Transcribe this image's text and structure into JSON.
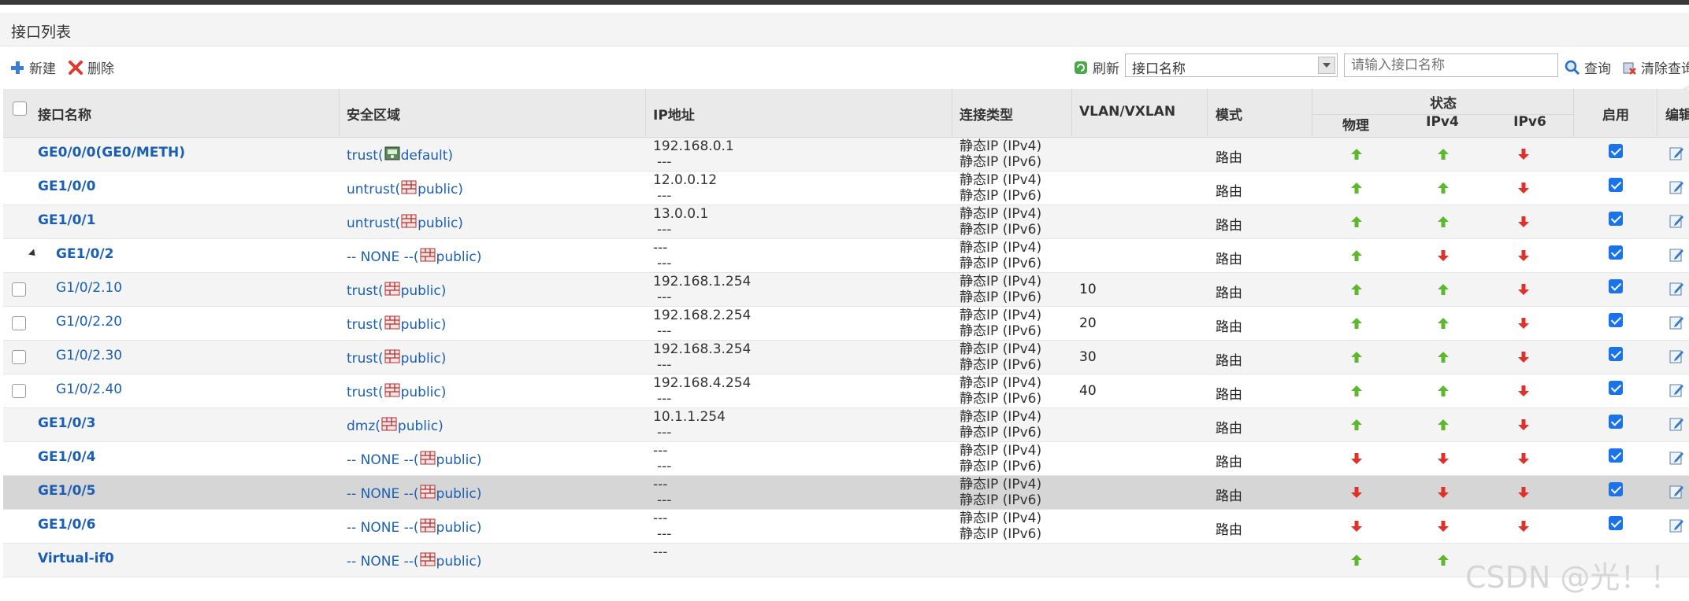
{
  "panel": {
    "title": "接口列表"
  },
  "toolbar": {
    "new_label": "新建",
    "delete_label": "删除",
    "refresh_label": "刷新",
    "filter_field": "接口名称",
    "search_placeholder": "请输入接口名称",
    "query_label": "查询",
    "clear_label": "清除查询"
  },
  "table": {
    "headers": {
      "name": "接口名称",
      "zone": "安全区域",
      "ip": "IP地址",
      "conn": "连接类型",
      "vlan": "VLAN/VXLAN",
      "mode": "模式",
      "status": "状态",
      "physical": "物理",
      "ipv4": "IPv4",
      "ipv6": "IPv6",
      "enable": "启用",
      "edit": "编辑"
    },
    "rows": [
      {
        "name": "GE0/0/0(GE0/METH)",
        "zone_prefix": "trust(",
        "zone_icon": "default-zone-icon",
        "zone_suffix": "default)",
        "ip1": "192.168.0.1",
        "ip2": "---",
        "conn1": "静态IP (IPv4)",
        "conn2": "静态IP (IPv6)",
        "vlan": "",
        "mode": "路由",
        "phys": "up",
        "v4": "up",
        "v6": "down",
        "enabled": true,
        "checkbox": false,
        "expander": false,
        "sub": false
      },
      {
        "name": "GE1/0/0",
        "zone_prefix": "untrust(",
        "zone_icon": "firewall-zone-icon",
        "zone_suffix": "public)",
        "ip1": "12.0.0.12",
        "ip2": "---",
        "conn1": "静态IP (IPv4)",
        "conn2": "静态IP (IPv6)",
        "vlan": "",
        "mode": "路由",
        "phys": "up",
        "v4": "up",
        "v6": "down",
        "enabled": true,
        "checkbox": false,
        "expander": false,
        "sub": false
      },
      {
        "name": "GE1/0/1",
        "zone_prefix": "untrust(",
        "zone_icon": "firewall-zone-icon",
        "zone_suffix": "public)",
        "ip1": "13.0.0.1",
        "ip2": "---",
        "conn1": "静态IP (IPv4)",
        "conn2": "静态IP (IPv6)",
        "vlan": "",
        "mode": "路由",
        "phys": "up",
        "v4": "up",
        "v6": "down",
        "enabled": true,
        "checkbox": false,
        "expander": false,
        "sub": false
      },
      {
        "name": "GE1/0/2",
        "zone_prefix": "-- NONE --(",
        "zone_icon": "firewall-zone-icon",
        "zone_suffix": "public)",
        "ip1": "---",
        "ip2": "---",
        "conn1": "静态IP (IPv4)",
        "conn2": "静态IP (IPv6)",
        "vlan": "",
        "mode": "路由",
        "phys": "up",
        "v4": "down",
        "v6": "down",
        "enabled": true,
        "checkbox": false,
        "expander": true,
        "sub": false
      },
      {
        "name": "G1/0/2.10",
        "zone_prefix": "trust(",
        "zone_icon": "firewall-zone-icon",
        "zone_suffix": "public)",
        "ip1": "192.168.1.254",
        "ip2": "---",
        "conn1": "静态IP (IPv4)",
        "conn2": "静态IP (IPv6)",
        "vlan": "10",
        "mode": "路由",
        "phys": "up",
        "v4": "up",
        "v6": "down",
        "enabled": true,
        "checkbox": true,
        "expander": false,
        "sub": true
      },
      {
        "name": "G1/0/2.20",
        "zone_prefix": "trust(",
        "zone_icon": "firewall-zone-icon",
        "zone_suffix": "public)",
        "ip1": "192.168.2.254",
        "ip2": "---",
        "conn1": "静态IP (IPv4)",
        "conn2": "静态IP (IPv6)",
        "vlan": "20",
        "mode": "路由",
        "phys": "up",
        "v4": "up",
        "v6": "down",
        "enabled": true,
        "checkbox": true,
        "expander": false,
        "sub": true
      },
      {
        "name": "G1/0/2.30",
        "zone_prefix": "trust(",
        "zone_icon": "firewall-zone-icon",
        "zone_suffix": "public)",
        "ip1": "192.168.3.254",
        "ip2": "---",
        "conn1": "静态IP (IPv4)",
        "conn2": "静态IP (IPv6)",
        "vlan": "30",
        "mode": "路由",
        "phys": "up",
        "v4": "up",
        "v6": "down",
        "enabled": true,
        "checkbox": true,
        "expander": false,
        "sub": true
      },
      {
        "name": "G1/0/2.40",
        "zone_prefix": "trust(",
        "zone_icon": "firewall-zone-icon",
        "zone_suffix": "public)",
        "ip1": "192.168.4.254",
        "ip2": "---",
        "conn1": "静态IP (IPv4)",
        "conn2": "静态IP (IPv6)",
        "vlan": "40",
        "mode": "路由",
        "phys": "up",
        "v4": "up",
        "v6": "down",
        "enabled": true,
        "checkbox": true,
        "expander": false,
        "sub": true
      },
      {
        "name": "GE1/0/3",
        "zone_prefix": "dmz(",
        "zone_icon": "firewall-zone-icon",
        "zone_suffix": "public)",
        "ip1": "10.1.1.254",
        "ip2": "---",
        "conn1": "静态IP (IPv4)",
        "conn2": "静态IP (IPv6)",
        "vlan": "",
        "mode": "路由",
        "phys": "up",
        "v4": "up",
        "v6": "down",
        "enabled": true,
        "checkbox": false,
        "expander": false,
        "sub": false
      },
      {
        "name": "GE1/0/4",
        "zone_prefix": "-- NONE --(",
        "zone_icon": "firewall-zone-icon",
        "zone_suffix": "public)",
        "ip1": "---",
        "ip2": "---",
        "conn1": "静态IP (IPv4)",
        "conn2": "静态IP (IPv6)",
        "vlan": "",
        "mode": "路由",
        "phys": "down",
        "v4": "down",
        "v6": "down",
        "enabled": true,
        "checkbox": false,
        "expander": false,
        "sub": false
      },
      {
        "name": "GE1/0/5",
        "zone_prefix": "-- NONE --(",
        "zone_icon": "firewall-zone-icon",
        "zone_suffix": "public)",
        "ip1": "---",
        "ip2": "---",
        "conn1": "静态IP (IPv4)",
        "conn2": "静态IP (IPv6)",
        "vlan": "",
        "mode": "路由",
        "phys": "down",
        "v4": "down",
        "v6": "down",
        "enabled": true,
        "checkbox": false,
        "expander": false,
        "sub": false,
        "selected": true
      },
      {
        "name": "GE1/0/6",
        "zone_prefix": "-- NONE --(",
        "zone_icon": "firewall-zone-icon",
        "zone_suffix": "public)",
        "ip1": "---",
        "ip2": "---",
        "conn1": "静态IP (IPv4)",
        "conn2": "静态IP (IPv6)",
        "vlan": "",
        "mode": "路由",
        "phys": "down",
        "v4": "down",
        "v6": "down",
        "enabled": true,
        "checkbox": false,
        "expander": false,
        "sub": false
      },
      {
        "name": "Virtual-if0",
        "zone_prefix": "-- NONE --(",
        "zone_icon": "firewall-zone-icon",
        "zone_suffix": "public)",
        "ip1": "---",
        "ip2": "",
        "conn1": "",
        "conn2": "",
        "vlan": "",
        "mode": "",
        "phys": "up",
        "v4": "up",
        "v6": "",
        "enabled": null,
        "checkbox": false,
        "expander": false,
        "sub": false
      }
    ]
  },
  "colors": {
    "link": "#1a5fb4",
    "up": "#5cb82e",
    "down": "#e0302a",
    "header_bg": "#eaeaea"
  },
  "watermark": "CSDN @光！！"
}
